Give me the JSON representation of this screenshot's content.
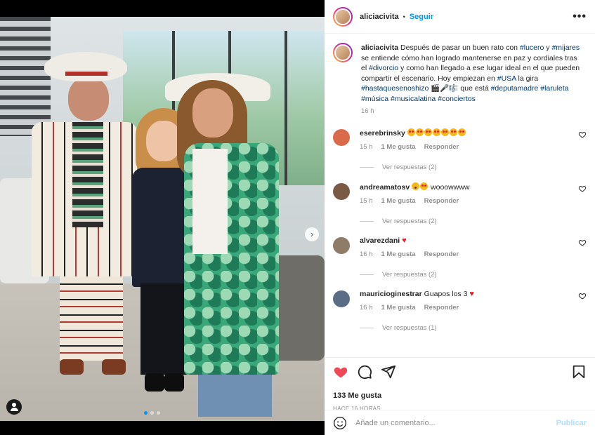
{
  "post": {
    "username": "aliciacivita",
    "follow_label": "Seguir",
    "dot_separator": "•",
    "more_icon": "more-horizontal-icon",
    "caption": {
      "username": "aliciacivita",
      "parts": [
        {
          "t": "Después de pasar un buen rato con "
        },
        {
          "t": "#lucero",
          "tag": true
        },
        {
          "t": " y "
        },
        {
          "t": "#mijares",
          "tag": true
        },
        {
          "t": " se entiende cómo han logrado mantenerse en paz y cordiales tras el "
        },
        {
          "t": "#divorcio",
          "tag": true
        },
        {
          "t": " y como han llegado a ese lugar ideal en el que pueden compartir el escenario. Hoy empiezan en "
        },
        {
          "t": "#USA",
          "tag": true
        },
        {
          "t": " la gira "
        },
        {
          "t": "#hastaquesenoshizo",
          "tag": true
        },
        {
          "t": " 🎬🎤🎼 que está "
        },
        {
          "t": "#deputamadre",
          "tag": true
        },
        {
          "t": " "
        },
        {
          "t": "#laruleta",
          "tag": true
        },
        {
          "t": " "
        },
        {
          "t": "#música",
          "tag": true
        },
        {
          "t": " "
        },
        {
          "t": "#musicalatina",
          "tag": true
        },
        {
          "t": " "
        },
        {
          "t": "#conciertos",
          "tag": true
        }
      ],
      "time": "16 h"
    },
    "comments": [
      {
        "user": "eserebrinsky",
        "emoji": "love",
        "emoji_count": 7,
        "text": "",
        "time": "15 h",
        "likes": "1 Me gusta",
        "reply": "Responder",
        "replies": "Ver respuestas (2)",
        "avatar": "#d96a4a"
      },
      {
        "user": "andreamatosv",
        "emoji": "wow+love",
        "emoji_count": 0,
        "text": "wooowwww",
        "time": "15 h",
        "likes": "1 Me gusta",
        "reply": "Responder",
        "replies": "Ver respuestas (2)",
        "avatar": "#7a5a44"
      },
      {
        "user": "alvarezdani",
        "emoji": "heart",
        "emoji_count": 0,
        "text": "",
        "time": "16 h",
        "likes": "1 Me gusta",
        "reply": "Responder",
        "replies": "Ver respuestas (2)",
        "avatar": "#8e7b68"
      },
      {
        "user": "mauricioginestrar",
        "emoji": "heart-after",
        "emoji_count": 0,
        "text": "Guapos los 3",
        "time": "16 h",
        "likes": "1 Me gusta",
        "reply": "Responder",
        "replies": "Ver respuestas (1)",
        "avatar": "#5b6d86"
      }
    ],
    "likes_count": "133 Me gusta",
    "time_ago": "HACE 16 HORAS",
    "comment_placeholder": "Añade un comentario...",
    "publish_label": "Publicar"
  },
  "colors": {
    "link": "#0095f6",
    "hashtag": "#00376b",
    "like_red": "#ed4956",
    "muted": "#8e8e8e"
  }
}
